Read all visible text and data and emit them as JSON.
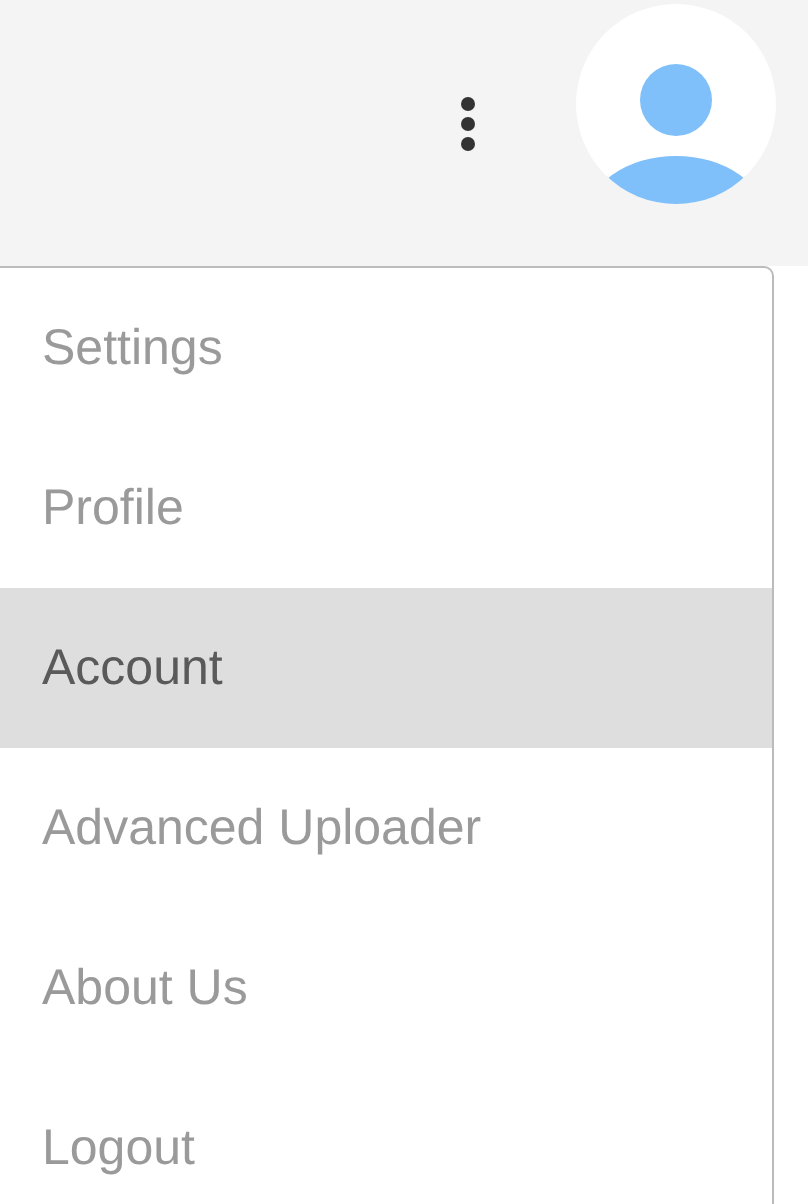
{
  "menu": {
    "items": [
      {
        "label": "Settings",
        "selected": false
      },
      {
        "label": "Profile",
        "selected": false
      },
      {
        "label": "Account",
        "selected": true
      },
      {
        "label": "Advanced Uploader",
        "selected": false
      },
      {
        "label": "About Us",
        "selected": false
      },
      {
        "label": "Logout",
        "selected": false
      }
    ]
  }
}
